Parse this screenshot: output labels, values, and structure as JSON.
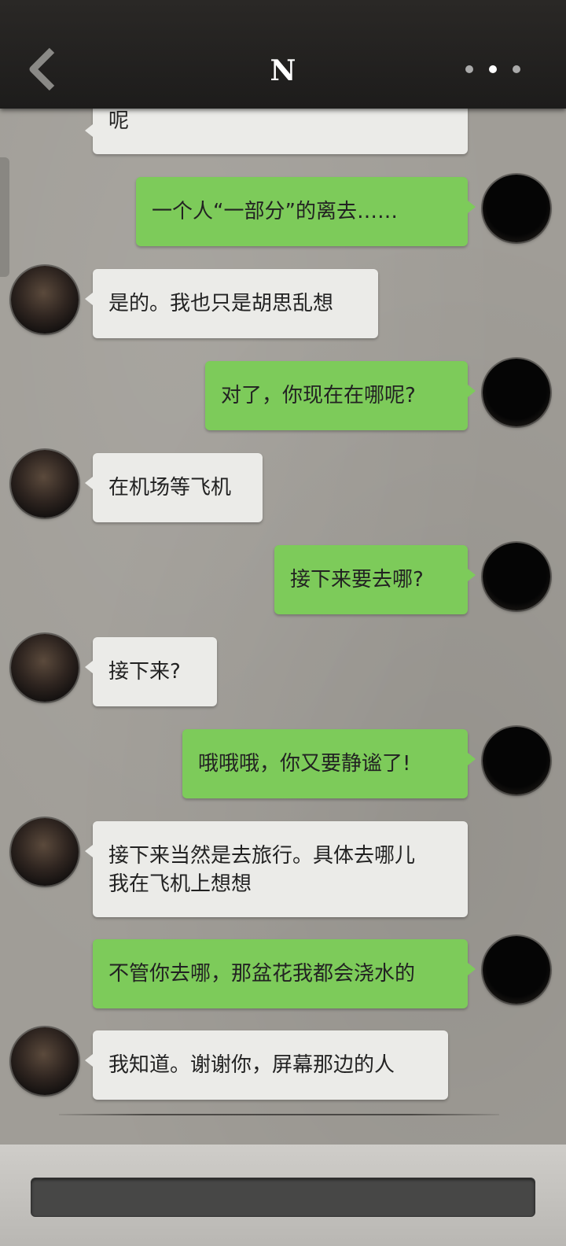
{
  "header": {
    "title": "N",
    "back_icon": "chevron-left-icon",
    "more_icon": "more-horizontal-icon"
  },
  "messages": [
    {
      "side": "in",
      "text": "呢",
      "partial": true
    },
    {
      "side": "out",
      "text": "一个人“一部分”的离去……"
    },
    {
      "side": "in",
      "text": "是的。我也只是胡思乱想"
    },
    {
      "side": "out",
      "text": "对了，你现在在哪呢?"
    },
    {
      "side": "in",
      "text": "在机场等飞机"
    },
    {
      "side": "out",
      "text": "接下来要去哪?"
    },
    {
      "side": "in",
      "text": "接下来?"
    },
    {
      "side": "out",
      "text": "哦哦哦，你又要静谧了!"
    },
    {
      "side": "in",
      "text": "接下来当然是去旅行。具体去哪儿\n我在飞机上想想"
    },
    {
      "side": "out",
      "text": "不管你去哪，那盆花我都会浇水的"
    },
    {
      "side": "in",
      "text": "我知道。谢谢你，屏幕那边的人"
    }
  ],
  "input": {
    "value": ""
  },
  "colors": {
    "incoming_bubble": "#ebebe8",
    "outgoing_bubble": "#7dcb5a",
    "header_bg": "#1f1e1c"
  }
}
